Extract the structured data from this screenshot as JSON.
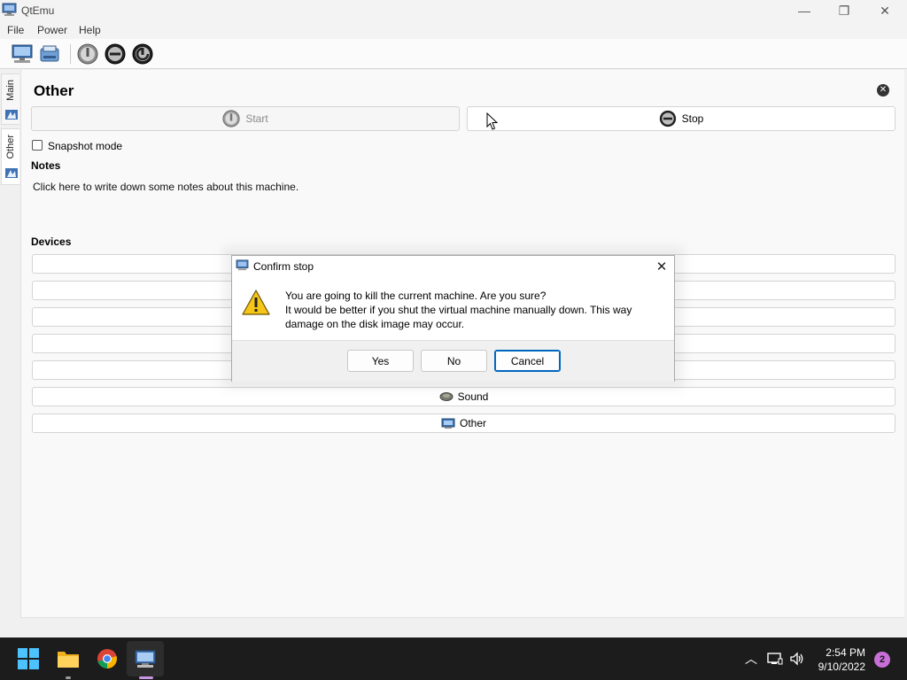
{
  "window": {
    "title": "QtEmu",
    "minimize": "—",
    "maximize": "❐",
    "close": "✕"
  },
  "menu": [
    "File",
    "Power",
    "Help"
  ],
  "sidebar": {
    "tabs": [
      "Main",
      "Other"
    ]
  },
  "panel": {
    "title": "Other",
    "start_label": "Start",
    "stop_label": "Stop",
    "snapshot_label": "Snapshot mode",
    "snapshot_checked": false,
    "notes_heading": "Notes",
    "notes_text": "Click here to write down some notes about this machine.",
    "devices_heading": "Devices",
    "devices": [
      "",
      "",
      "",
      "",
      "",
      "Sound",
      "Other"
    ]
  },
  "dialog": {
    "title": "Confirm stop",
    "message_line1": "You are going to kill the current machine. Are you sure?",
    "message_line2": "It would be better if you shut the virtual machine manually down. This way damage on the disk image may occur.",
    "buttons": {
      "yes": "Yes",
      "no": "No",
      "cancel": "Cancel"
    },
    "default_button": "Cancel"
  },
  "taskbar": {
    "time": "2:54 PM",
    "date": "9/10/2022",
    "notification_count": "2",
    "apps": [
      "windows-start",
      "file-explorer",
      "chrome",
      "qtemu"
    ]
  },
  "colors": {
    "accent": "#0067c0",
    "taskbar_bg": "#1c1c1c",
    "notification_badge": "#c96fd8"
  }
}
